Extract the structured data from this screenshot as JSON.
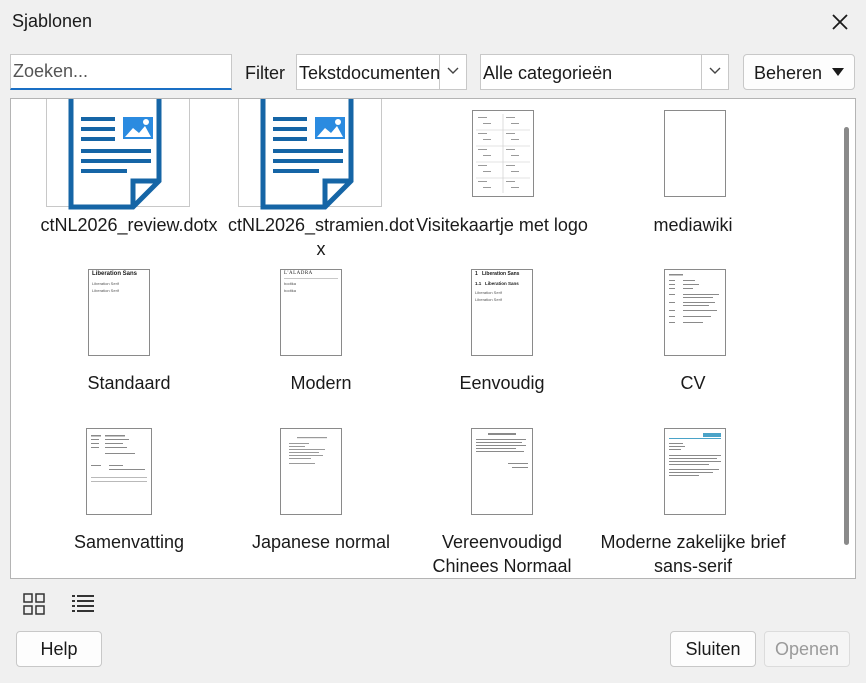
{
  "dialog": {
    "title": "Sjablonen"
  },
  "toolbar": {
    "search_placeholder": "Zoeken...",
    "filter_label": "Filter",
    "filter_value": "Tekstdocumenten",
    "category_value": "Alle categorieën",
    "manage_label": "Beheren"
  },
  "templates": [
    {
      "label": "ctNL2026_review.dotx"
    },
    {
      "label": "ctNL2026_stramien.dotx"
    },
    {
      "label": "Visitekaartje met logo"
    },
    {
      "label": "mediawiki"
    },
    {
      "label": "Standaard",
      "preview_heading": "Liberation Sans",
      "preview_lines": [
        "Liberation Serif",
        "Liberation Serif"
      ]
    },
    {
      "label": "Modern",
      "preview_heading": "L'ALADRA",
      "preview_lines": [
        "bodtka",
        "bodtka"
      ]
    },
    {
      "label": "Eenvoudig",
      "preview_heading": "1   Liberation Sans",
      "preview_sub": "1.1   Liberation Sans",
      "preview_lines": [
        "Liberation Serif",
        "Liberation Serif"
      ]
    },
    {
      "label": "CV"
    },
    {
      "label": "Samenvatting"
    },
    {
      "label": "Japanese normal"
    },
    {
      "label": "Vereenvoudigd Chinees Normaal"
    },
    {
      "label": "Moderne zakelijke brief sans-serif"
    }
  ],
  "footer": {
    "help_label": "Help",
    "close_label": "Sluiten",
    "open_label": "Openen"
  },
  "colors": {
    "accent": "#1a6fc4",
    "icon_blue": "#1565a6"
  }
}
